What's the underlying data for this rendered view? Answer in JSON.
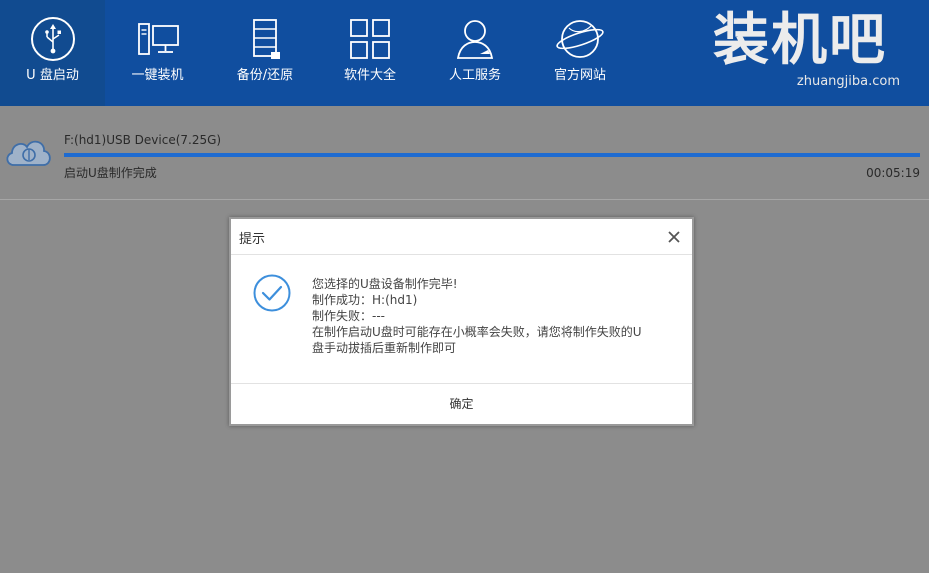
{
  "nav": {
    "items": [
      {
        "label": "U 盘启动",
        "icon": "usb-icon",
        "active": true
      },
      {
        "label": "一键装机",
        "icon": "computer-icon",
        "active": false
      },
      {
        "label": "备份/还原",
        "icon": "backup-icon",
        "active": false
      },
      {
        "label": "软件大全",
        "icon": "apps-grid-icon",
        "active": false
      },
      {
        "label": "人工服务",
        "icon": "support-person-icon",
        "active": false
      },
      {
        "label": "官方网站",
        "icon": "globe-icon",
        "active": false
      }
    ]
  },
  "brand": {
    "name": "装机吧",
    "url": "zhuangjiba.com"
  },
  "device": {
    "name": "F:(hd1)USB Device(7.25G)",
    "status": "启动U盘制作完成",
    "elapsed": "00:05:19",
    "progress_percent": 100,
    "icon": "cloud-usb-icon"
  },
  "dialog": {
    "title": "提示",
    "close_icon": "close-icon",
    "status_icon": "check-circle-icon",
    "lines": [
      "您选择的U盘设备制作完毕!",
      "制作成功：H:(hd1)",
      "制作失败：---",
      "在制作启动U盘时可能存在小概率会失败，请您将制作失败的U",
      "盘手动拔插后重新制作即可"
    ],
    "ok_label": "确定"
  },
  "colors": {
    "topbar": "#104e9f",
    "topbar_active": "#114b90",
    "overlay": "#8c8c8c",
    "progress": "#1e6bd1",
    "check": "#3d8fdc"
  }
}
